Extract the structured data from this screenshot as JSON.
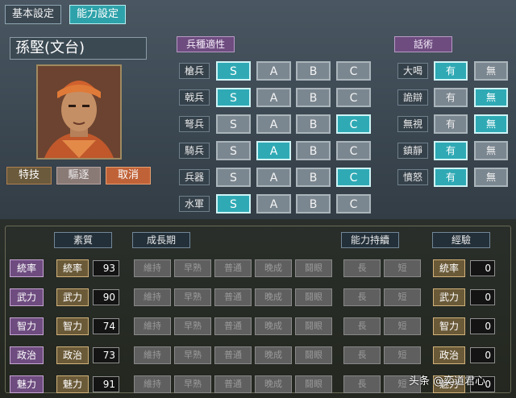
{
  "tabs": [
    {
      "label": "基本設定",
      "active": false
    },
    {
      "label": "能力設定",
      "active": true
    }
  ],
  "officer": {
    "name": "孫堅(文台)"
  },
  "portrait_actions": {
    "skill": "特技",
    "expel": "驅逐",
    "cancel": "取消"
  },
  "troop_section": {
    "title": "兵種適性",
    "grades": [
      "S",
      "A",
      "B",
      "C"
    ],
    "rows": [
      {
        "label": "槍兵",
        "selected": "S"
      },
      {
        "label": "戟兵",
        "selected": "S"
      },
      {
        "label": "弩兵",
        "selected": "C"
      },
      {
        "label": "騎兵",
        "selected": "A"
      },
      {
        "label": "兵器",
        "selected": "C"
      },
      {
        "label": "水軍",
        "selected": "S"
      }
    ]
  },
  "speech_section": {
    "title": "話術",
    "options": [
      "有",
      "無"
    ],
    "rows": [
      {
        "label": "大喝",
        "selected": "有"
      },
      {
        "label": "詭辯",
        "selected": "無"
      },
      {
        "label": "無視",
        "selected": "無"
      },
      {
        "label": "鎮靜",
        "selected": "有"
      },
      {
        "label": "憤怒",
        "selected": "有"
      }
    ]
  },
  "stats_section": {
    "headers": {
      "quality": "素質",
      "growth": "成長期",
      "retention": "能力持續",
      "experience": "經驗"
    },
    "growth_options": [
      "維持",
      "早熟",
      "普通",
      "晚成",
      "鬪眼"
    ],
    "retention_options": [
      "長",
      "短"
    ],
    "rows": [
      {
        "label": "統率",
        "attr": "統率",
        "value": "93",
        "exp_attr": "統率",
        "exp": "0"
      },
      {
        "label": "武力",
        "attr": "武力",
        "value": "90",
        "exp_attr": "武力",
        "exp": "0"
      },
      {
        "label": "智力",
        "attr": "智力",
        "value": "74",
        "exp_attr": "智力",
        "exp": "0"
      },
      {
        "label": "政治",
        "attr": "政治",
        "value": "73",
        "exp_attr": "政治",
        "exp": "0"
      },
      {
        "label": "魅力",
        "attr": "魅力",
        "value": "91",
        "exp_attr": "魅力",
        "exp": "0"
      }
    ]
  },
  "watermark": "头条 @奕道君心"
}
